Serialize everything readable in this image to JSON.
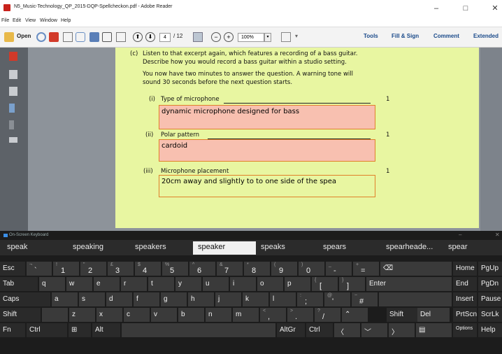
{
  "window": {
    "title": "N5_Music-Technology_QP_2015-DQP-Spellcheckon.pdf - Adobe Reader",
    "minimize": "–",
    "maximize": "□",
    "close": "✕"
  },
  "menu": [
    "File",
    "Edit",
    "View",
    "Window",
    "Help"
  ],
  "toolbar": {
    "open": "Open",
    "page_current": "4",
    "page_total": "/ 12",
    "zoom": "100%",
    "tools": "Tools",
    "fill_sign": "Fill & Sign",
    "comment": "Comment",
    "extended": "Extended"
  },
  "document": {
    "q_label": "(c)",
    "q_line1": "Listen to that excerpt again, which features a recording of a bass guitar.",
    "q_line2": "Describe how you would record a bass guitar within a studio setting.",
    "q_line3": "You now have two minutes to answer the question.  A warning tone will",
    "q_line4": "sound 30 seconds before the next question starts.",
    "parts": [
      {
        "num": "(i)",
        "label": "Type of microphone",
        "mark": "1",
        "answer": "dynamic microphone designed for bass"
      },
      {
        "num": "(ii)",
        "label": "Polar pattern",
        "mark": "1",
        "answer": "cardoid"
      },
      {
        "num": "(iii)",
        "label": "Microphone placement",
        "mark": "1",
        "answer": "20cm away and slightly to to one side of the spea"
      }
    ]
  },
  "keyboard": {
    "title": "On-Screen Keyboard",
    "suggestions": [
      "speak",
      "speaking",
      "speakers",
      "speaker",
      "speaks",
      "spears",
      "spearheade...",
      "spear"
    ],
    "selected_suggestion": "speaker"
  },
  "colors": {
    "page_bg": "#e8f6a1",
    "field_bg": "#f8c0b0",
    "field_border": "#e0802a",
    "osk_bg": "#1c1c1c"
  }
}
